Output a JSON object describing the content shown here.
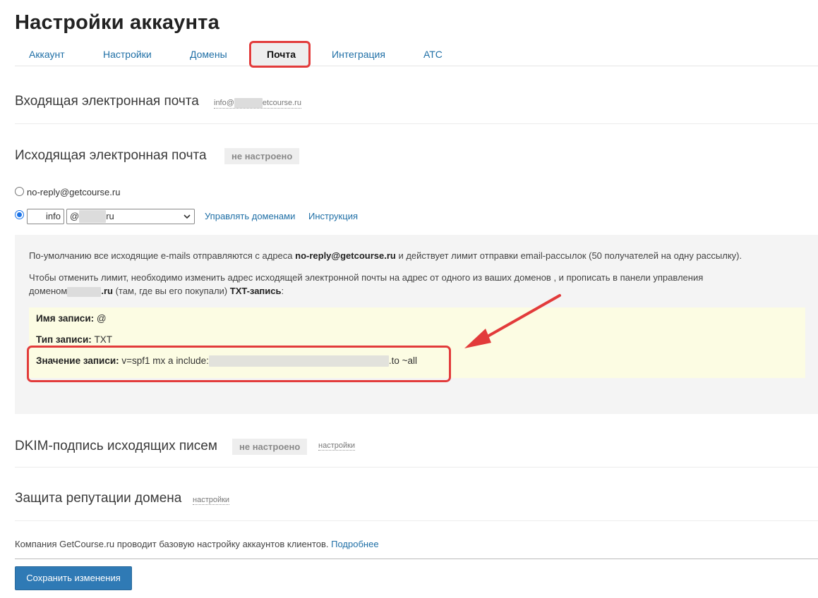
{
  "page": {
    "title": "Настройки аккаунта"
  },
  "tabs": [
    {
      "label": "Аккаунт"
    },
    {
      "label": "Настройки"
    },
    {
      "label": "Домены"
    },
    {
      "label": "Почта",
      "active": true
    },
    {
      "label": "Интеграция"
    },
    {
      "label": "АТС"
    }
  ],
  "incoming": {
    "title": "Входящая электронная почта",
    "email_prefix": "info@",
    "email_suffix": "etcourse.ru"
  },
  "outgoing": {
    "title": "Исходящая электронная почта",
    "status": "не настроено",
    "option_default": "no-reply@getcourse.ru",
    "local_part": "info",
    "domain_prefix": "@",
    "domain_suffix": "ru",
    "manage_domains_link": "Управлять доменами",
    "instruction_link": "Инструкция"
  },
  "info": {
    "p1_a": "По-умолчанию все исходящие e-mails отправляются с адреса ",
    "p1_email": "no-reply@getcourse.ru",
    "p1_b": " и действует лимит отправки email-рассылок (50 получателей на одну рассылку).",
    "p2_line1": "Чтобы отменить лимит, необходимо изменить адрес исходящей электронной почты на адрес от одного из ваших доменов   , и прописать в панели управления",
    "p2_domain_word": "доменом",
    "p2_domain_tld": ".ru",
    "p2_middle": " (там, где вы его покупали) ",
    "p2_txt": "TXT-запись",
    "p2_end": ":"
  },
  "record": {
    "name_label": "Имя записи:",
    "name_value": "@",
    "type_label": "Тип записи:",
    "type_value": "TXT",
    "value_label": "Значение записи:",
    "value_prefix": "v=spf1 mx a include:",
    "value_suffix": ".to ~all"
  },
  "dkim": {
    "title": "DKIM-подпись исходящих писем",
    "status": "не настроено",
    "settings_link": "настройки"
  },
  "reputation": {
    "title": "Защита репутации домена",
    "settings_link": "настройки"
  },
  "footer": {
    "note": "Компания GetCourse.ru проводит базовую настройку аккаунтов клиентов. ",
    "more_link": "Подробнее",
    "save_button": "Сохранить изменения"
  },
  "colors": {
    "accent_link": "#1f6fa6",
    "highlight_red": "#e23b3b",
    "save_button": "#2f7ab5",
    "record_background": "#fcfce3"
  }
}
